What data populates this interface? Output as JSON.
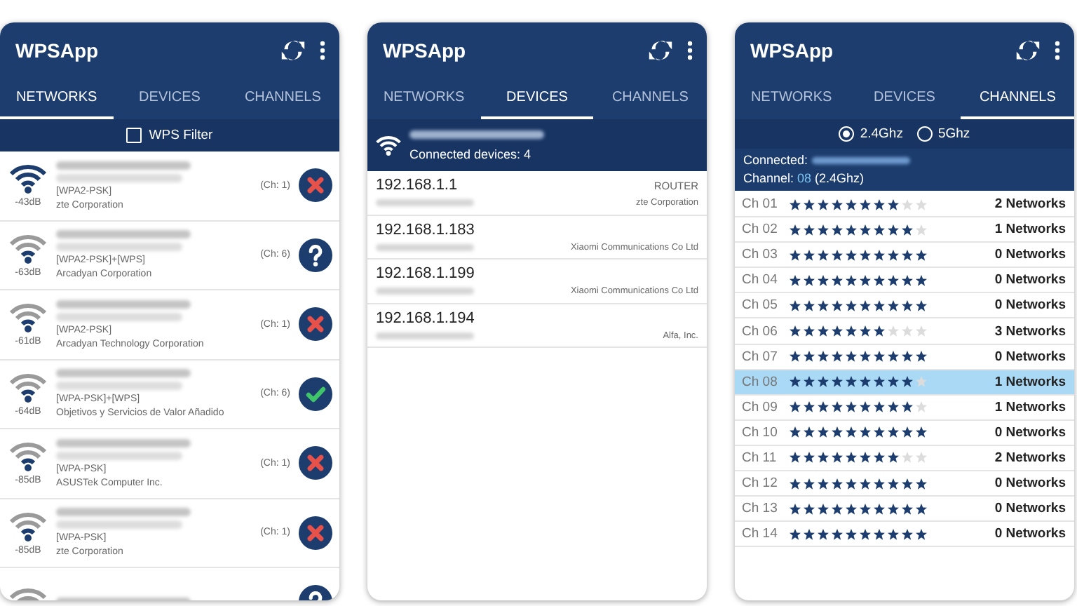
{
  "screens": [
    {
      "kind": "networks",
      "title": "WPSApp",
      "tabs": [
        {
          "label": "NETWORKS",
          "selected": true
        },
        {
          "label": "DEVICES",
          "selected": false
        },
        {
          "label": "CHANNELS",
          "selected": false
        }
      ],
      "wps_filter": {
        "label": "WPS Filter",
        "checked": false
      },
      "networks": [
        {
          "signal": "-43dB",
          "security": "[WPA2-PSK]",
          "vendor": "zte Corporation",
          "channel": "(Ch: 1)",
          "kind": "locked"
        },
        {
          "signal": "-63dB",
          "security": "[WPA2-PSK]+[WPS]",
          "vendor": "Arcadyan Corporation",
          "channel": "(Ch: 6)",
          "kind": "unknown"
        },
        {
          "signal": "-61dB",
          "security": "[WPA2-PSK]",
          "vendor": "Arcadyan Technology Corporation",
          "channel": "(Ch: 1)",
          "kind": "locked"
        },
        {
          "signal": "-64dB",
          "security": "[WPA-PSK]+[WPS]",
          "vendor": "Objetivos y Servicios de Valor Añadido",
          "channel": "(Ch: 6)",
          "kind": "ok"
        },
        {
          "signal": "-85dB",
          "security": "[WPA-PSK]",
          "vendor": "ASUSTek Computer Inc.",
          "channel": "(Ch: 1)",
          "kind": "locked"
        },
        {
          "signal": "-85dB",
          "security": "[WPA-PSK]",
          "vendor": "zte Corporation",
          "channel": "(Ch: 1)",
          "kind": "locked"
        },
        {
          "kind": "unknown"
        }
      ]
    },
    {
      "kind": "devices",
      "title": "WPSApp",
      "tabs": [
        {
          "label": "NETWORKS",
          "selected": false
        },
        {
          "label": "DEVICES",
          "selected": true
        },
        {
          "label": "CHANNELS",
          "selected": false
        }
      ],
      "connected_label": "Connected devices: 4",
      "devices": [
        {
          "ip": "192.168.1.1",
          "type": "ROUTER",
          "vendor": "zte Corporation"
        },
        {
          "ip": "192.168.1.183",
          "vendor": "Xiaomi Communications Co Ltd"
        },
        {
          "ip": "192.168.1.199",
          "vendor": "Xiaomi Communications Co Ltd"
        },
        {
          "ip": "192.168.1.194",
          "vendor": "Alfa, Inc."
        }
      ]
    },
    {
      "kind": "channels",
      "title": "WPSApp",
      "tabs": [
        {
          "label": "NETWORKS",
          "selected": false
        },
        {
          "label": "DEVICES",
          "selected": false
        },
        {
          "label": "CHANNELS",
          "selected": true
        }
      ],
      "bands": [
        {
          "label": "2.4Ghz",
          "selected": true
        },
        {
          "label": "5Ghz",
          "selected": false
        }
      ],
      "connected_label": "Connected:",
      "channel_label": "Channel:",
      "channel_value": "08",
      "channel_band": "(2.4Ghz)",
      "channels": [
        {
          "name": "Ch 01",
          "stars": 8,
          "count": "2 Networks",
          "selected": false
        },
        {
          "name": "Ch 02",
          "stars": 9,
          "count": "1 Networks",
          "selected": false
        },
        {
          "name": "Ch 03",
          "stars": 10,
          "count": "0 Networks",
          "selected": false
        },
        {
          "name": "Ch 04",
          "stars": 10,
          "count": "0 Networks",
          "selected": false
        },
        {
          "name": "Ch 05",
          "stars": 10,
          "count": "0 Networks",
          "selected": false
        },
        {
          "name": "Ch 06",
          "stars": 7,
          "count": "3 Networks",
          "selected": false
        },
        {
          "name": "Ch 07",
          "stars": 10,
          "count": "0 Networks",
          "selected": false
        },
        {
          "name": "Ch 08",
          "stars": 9,
          "count": "1 Networks",
          "selected": true
        },
        {
          "name": "Ch 09",
          "stars": 9,
          "count": "1 Networks",
          "selected": false
        },
        {
          "name": "Ch 10",
          "stars": 10,
          "count": "0 Networks",
          "selected": false
        },
        {
          "name": "Ch 11",
          "stars": 8,
          "count": "2 Networks",
          "selected": false
        },
        {
          "name": "Ch 12",
          "stars": 10,
          "count": "0 Networks",
          "selected": false
        },
        {
          "name": "Ch 13",
          "stars": 10,
          "count": "0 Networks",
          "selected": false
        },
        {
          "name": "Ch 14",
          "stars": 10,
          "count": "0 Networks",
          "selected": false
        }
      ]
    }
  ]
}
